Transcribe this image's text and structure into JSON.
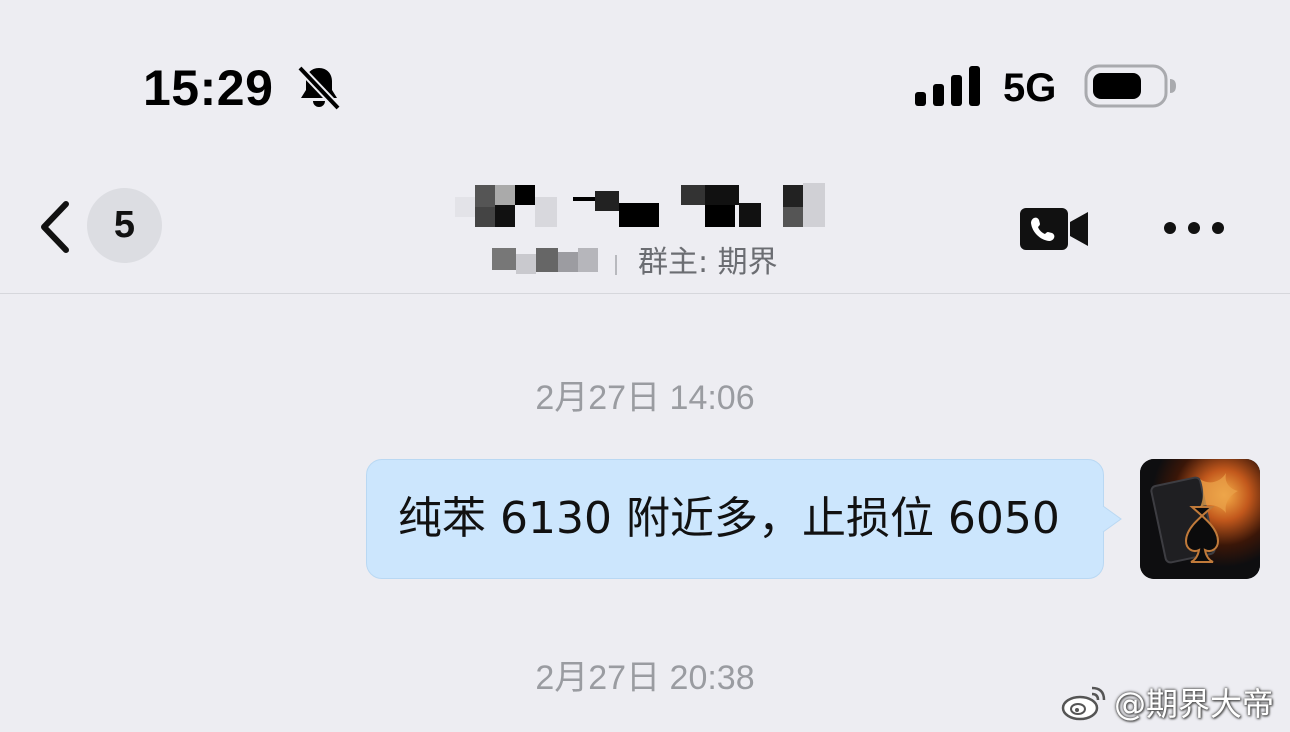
{
  "status_bar": {
    "time": "15:29",
    "mute_icon": "bell-slash-icon",
    "signal_icon": "cellular-signal-icon",
    "network": "5G",
    "battery_icon": "battery-icon"
  },
  "nav": {
    "back_icon": "chevron-left-icon",
    "unread_count": "5",
    "subtitle_owner": "群主: 期界",
    "video_icon": "video-camera-icon",
    "more_icon": "ellipsis-icon"
  },
  "messages": [
    {
      "type": "timestamp",
      "text": "2月27日 14:06"
    },
    {
      "type": "outgoing",
      "text": "纯苯 6130 附近多，止损位 6050"
    },
    {
      "type": "timestamp",
      "text": "2月27日 20:38"
    }
  ],
  "watermark": {
    "icon": "weibo-icon",
    "text": "@期界大帝"
  },
  "colors": {
    "background": "#ededf2",
    "bubble": "#cce6fd",
    "timestamp": "#9a9ca1"
  }
}
